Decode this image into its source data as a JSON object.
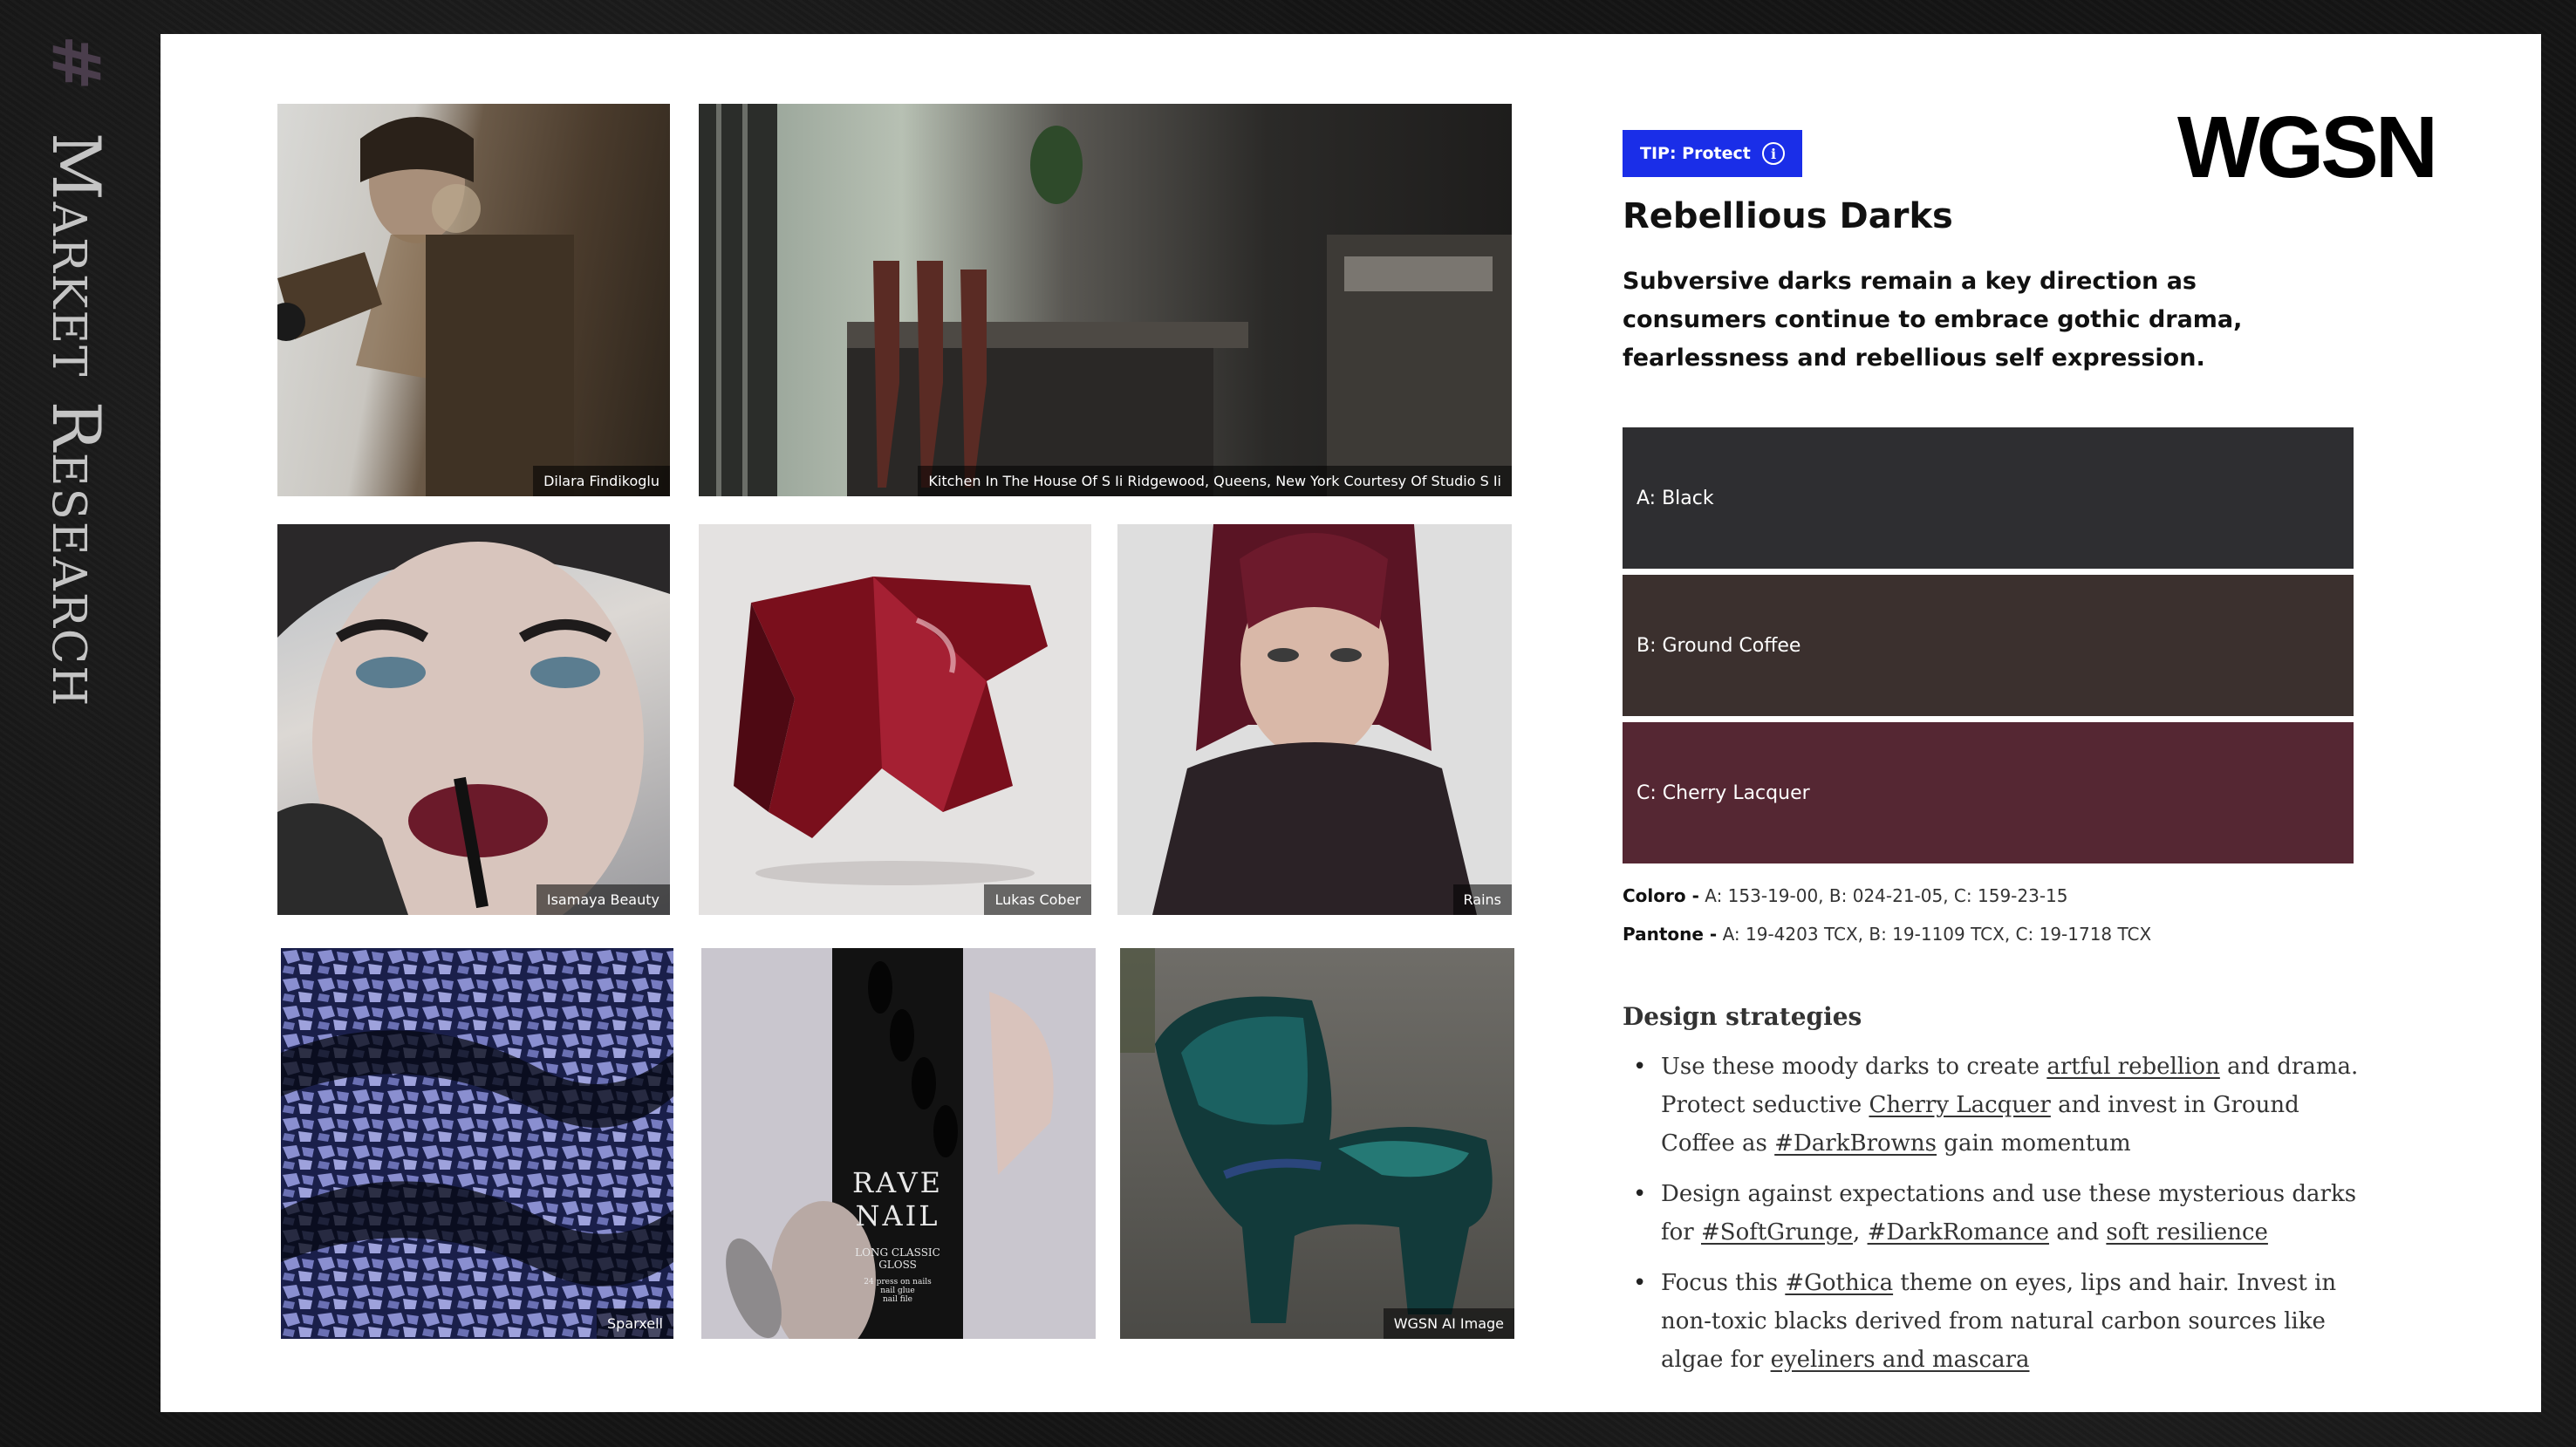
{
  "sidebar": {
    "hash": "#",
    "title": "Market Research"
  },
  "logo": "WGSN",
  "tip": {
    "label": "TIP: Protect",
    "info_glyph": "i"
  },
  "heading": "Rebellious Darks",
  "subheading": "Subversive darks remain a key direction as consumers continue to embrace gothic drama, fearlessness and rebellious self expression.",
  "swatches": [
    {
      "label": "A: Black",
      "color": "#2e2e31"
    },
    {
      "label": "B: Ground Coffee",
      "color": "#3b302e"
    },
    {
      "label": "C: Cherry Lacquer",
      "color": "#552733"
    }
  ],
  "codes": {
    "coloro_label": "Coloro -",
    "coloro_value": "A: 153-19-00, B: 024-21-05, C: 159-23-15",
    "pantone_label": "Pantone -",
    "pantone_value": "A: 19-4203 TCX, B: 19-1109 TCX, C: 19-1718 TCX"
  },
  "design_title": "Design strategies",
  "strategies": [
    {
      "p1": "Use these moody darks to create ",
      "l1": "artful rebellion",
      "p2": " and drama. Protect seductive ",
      "l2": "Cherry Lacquer",
      "p3": " and invest in Ground Coffee as ",
      "l3": "#DarkBrowns",
      "p4": " gain momentum"
    },
    {
      "p1": "Design against expectations and use these mysterious darks for ",
      "l1": "#SoftGrunge",
      "p2": ", ",
      "l2": "#DarkRomance",
      "p3": " and ",
      "l3": "soft resilience"
    },
    {
      "p1": "Focus this ",
      "l1": "#Gothica",
      "p2": " theme on eyes, lips and hair. Invest in non-toxic blacks derived from natural carbon sources like algae for ",
      "l2": "eyeliners and mascara"
    }
  ],
  "photos": [
    {
      "credit": "Dilara Findikoglu",
      "subject": "model-portrait"
    },
    {
      "credit": "Kitchen In The House Of S Ii Ridgewood, Queens, New York Courtesy Of Studio S Ii",
      "subject": "dark-kitchen"
    },
    {
      "credit": "Isamaya Beauty",
      "subject": "lipstick-portrait"
    },
    {
      "credit": "Lukas Cober",
      "subject": "red-lacquer-bag"
    },
    {
      "credit": "Rains",
      "subject": "model-red-hair"
    },
    {
      "credit": "Sparxell",
      "subject": "blue-crackle-fabric"
    },
    {
      "credit": "",
      "subject": "nail-product",
      "product_text": [
        "RAVE",
        "NAIL",
        "LONG CLASSIC",
        "GLOSS",
        "24 press on nails",
        "nail glue",
        "nail file"
      ]
    },
    {
      "credit": "WGSN AI Image",
      "subject": "iridescent-chair"
    }
  ]
}
